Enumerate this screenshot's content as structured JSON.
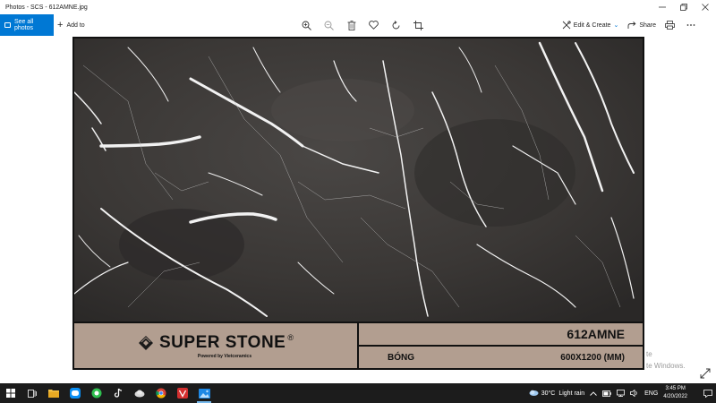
{
  "window": {
    "title": "Photos - SCS - 612AMNE.jpg",
    "controls": [
      "minimize",
      "maximize",
      "close"
    ]
  },
  "toolbar": {
    "see_all_label": "See all photos",
    "add_to_label": "Add to",
    "tools": [
      "zoom-in-icon",
      "zoom-out-icon",
      "delete-icon",
      "favorite-icon",
      "rotate-icon",
      "crop-icon"
    ],
    "edit_create_label": "Edit & Create",
    "share_label": "Share"
  },
  "image": {
    "brand": "SUPER STONE",
    "registered_mark": "®",
    "brand_tagline": "Powered by Vietceramics",
    "product_code": "612AMNE",
    "finish": "BÓNG",
    "size": "600X1200 (MM)",
    "label_color": "#b29e90"
  },
  "overlay": {
    "activate_line1": "te",
    "activate_line2": "te Windows."
  },
  "taskbar": {
    "weather_temp": "30°C",
    "weather_text": "Light rain",
    "language": "ENG",
    "time": "3:45 PM",
    "date": "4/20/2022",
    "accent": "#0078d4"
  }
}
